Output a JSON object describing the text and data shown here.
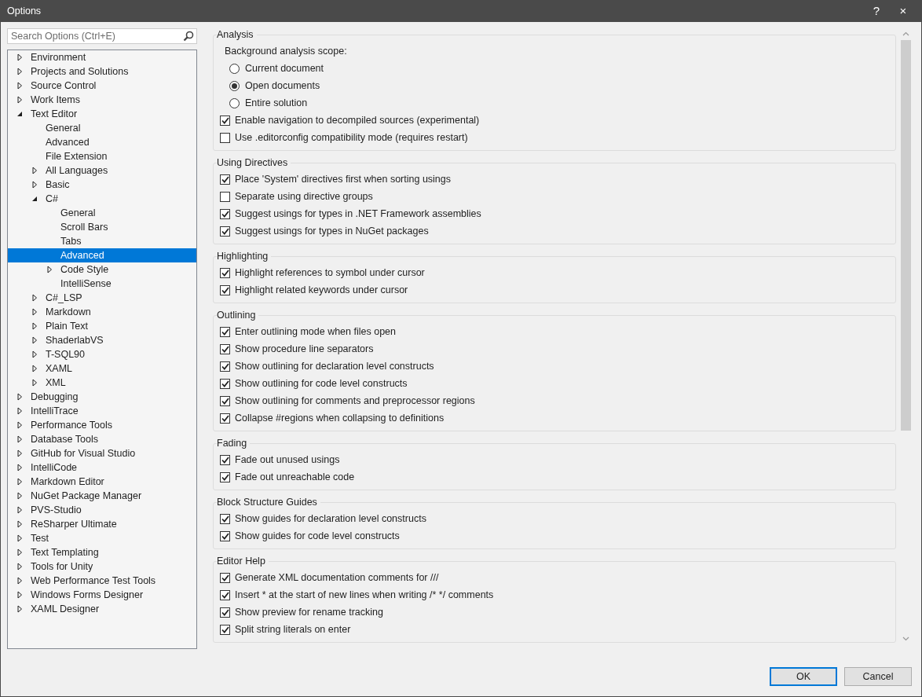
{
  "window": {
    "title": "Options",
    "help_glyph": "?",
    "close_glyph": "×"
  },
  "search": {
    "placeholder": "Search Options (Ctrl+E)"
  },
  "tree": [
    {
      "label": "Environment",
      "expanded": false,
      "selected": false
    },
    {
      "label": "Projects and Solutions",
      "expanded": false,
      "selected": false
    },
    {
      "label": "Source Control",
      "expanded": false,
      "selected": false
    },
    {
      "label": "Work Items",
      "expanded": false,
      "selected": false
    },
    {
      "label": "Text Editor",
      "expanded": true,
      "selected": false,
      "children": [
        {
          "label": "General",
          "selected": false
        },
        {
          "label": "Advanced",
          "selected": false
        },
        {
          "label": "File Extension",
          "selected": false
        },
        {
          "label": "All Languages",
          "expanded": false,
          "selected": false
        },
        {
          "label": "Basic",
          "expanded": false,
          "selected": false
        },
        {
          "label": "C#",
          "expanded": true,
          "selected": false,
          "children": [
            {
              "label": "General",
              "selected": false
            },
            {
              "label": "Scroll Bars",
              "selected": false
            },
            {
              "label": "Tabs",
              "selected": false
            },
            {
              "label": "Advanced",
              "selected": true
            },
            {
              "label": "Code Style",
              "expanded": false,
              "selected": false
            },
            {
              "label": "IntelliSense",
              "selected": false
            }
          ]
        },
        {
          "label": "C#_LSP",
          "expanded": false,
          "selected": false
        },
        {
          "label": "Markdown",
          "expanded": false,
          "selected": false
        },
        {
          "label": "Plain Text",
          "expanded": false,
          "selected": false
        },
        {
          "label": "ShaderlabVS",
          "expanded": false,
          "selected": false
        },
        {
          "label": "T-SQL90",
          "expanded": false,
          "selected": false
        },
        {
          "label": "XAML",
          "expanded": false,
          "selected": false
        },
        {
          "label": "XML",
          "expanded": false,
          "selected": false
        }
      ]
    },
    {
      "label": "Debugging",
      "expanded": false,
      "selected": false
    },
    {
      "label": "IntelliTrace",
      "expanded": false,
      "selected": false
    },
    {
      "label": "Performance Tools",
      "expanded": false,
      "selected": false
    },
    {
      "label": "Database Tools",
      "expanded": false,
      "selected": false
    },
    {
      "label": "GitHub for Visual Studio",
      "expanded": false,
      "selected": false
    },
    {
      "label": "IntelliCode",
      "expanded": false,
      "selected": false
    },
    {
      "label": "Markdown Editor",
      "expanded": false,
      "selected": false
    },
    {
      "label": "NuGet Package Manager",
      "expanded": false,
      "selected": false
    },
    {
      "label": "PVS-Studio",
      "expanded": false,
      "selected": false
    },
    {
      "label": "ReSharper Ultimate",
      "expanded": false,
      "selected": false
    },
    {
      "label": "Test",
      "expanded": false,
      "selected": false
    },
    {
      "label": "Text Templating",
      "expanded": false,
      "selected": false
    },
    {
      "label": "Tools for Unity",
      "expanded": false,
      "selected": false
    },
    {
      "label": "Web Performance Test Tools",
      "expanded": false,
      "selected": false
    },
    {
      "label": "Windows Forms Designer",
      "expanded": false,
      "selected": false
    },
    {
      "label": "XAML Designer",
      "expanded": false,
      "selected": false
    }
  ],
  "groups": [
    {
      "title": "Analysis",
      "options": [
        {
          "kind": "label",
          "label": "Background analysis scope:"
        },
        {
          "kind": "radio",
          "label": "Current document",
          "selected": false
        },
        {
          "kind": "radio",
          "label": "Open documents",
          "selected": true
        },
        {
          "kind": "radio",
          "label": "Entire solution",
          "selected": false
        },
        {
          "kind": "checkbox",
          "label": "Enable navigation to decompiled sources (experimental)",
          "checked": true
        },
        {
          "kind": "checkbox",
          "label": "Use .editorconfig compatibility mode (requires restart)",
          "checked": false
        }
      ]
    },
    {
      "title": "Using Directives",
      "options": [
        {
          "kind": "checkbox",
          "label": "Place 'System' directives first when sorting usings",
          "checked": true
        },
        {
          "kind": "checkbox",
          "label": "Separate using directive groups",
          "checked": false
        },
        {
          "kind": "checkbox",
          "label": "Suggest usings for types in .NET Framework assemblies",
          "checked": true
        },
        {
          "kind": "checkbox",
          "label": "Suggest usings for types in NuGet packages",
          "checked": true
        }
      ]
    },
    {
      "title": "Highlighting",
      "options": [
        {
          "kind": "checkbox",
          "label": "Highlight references to symbol under cursor",
          "checked": true
        },
        {
          "kind": "checkbox",
          "label": "Highlight related keywords under cursor",
          "checked": true
        }
      ]
    },
    {
      "title": "Outlining",
      "options": [
        {
          "kind": "checkbox",
          "label": "Enter outlining mode when files open",
          "checked": true
        },
        {
          "kind": "checkbox",
          "label": "Show procedure line separators",
          "checked": true
        },
        {
          "kind": "checkbox",
          "label": "Show outlining for declaration level constructs",
          "checked": true
        },
        {
          "kind": "checkbox",
          "label": "Show outlining for code level constructs",
          "checked": true
        },
        {
          "kind": "checkbox",
          "label": "Show outlining for comments and preprocessor regions",
          "checked": true
        },
        {
          "kind": "checkbox",
          "label": "Collapse #regions when collapsing to definitions",
          "checked": true
        }
      ]
    },
    {
      "title": "Fading",
      "options": [
        {
          "kind": "checkbox",
          "label": "Fade out unused usings",
          "checked": true
        },
        {
          "kind": "checkbox",
          "label": "Fade out unreachable code",
          "checked": true
        }
      ]
    },
    {
      "title": "Block Structure Guides",
      "options": [
        {
          "kind": "checkbox",
          "label": "Show guides for declaration level constructs",
          "checked": true
        },
        {
          "kind": "checkbox",
          "label": "Show guides for code level constructs",
          "checked": true
        }
      ]
    },
    {
      "title": "Editor Help",
      "options": [
        {
          "kind": "checkbox",
          "label": "Generate XML documentation comments for ///",
          "checked": true
        },
        {
          "kind": "checkbox",
          "label": "Insert * at the start of new lines when writing /* */ comments",
          "checked": true
        },
        {
          "kind": "checkbox",
          "label": "Show preview for rename tracking",
          "checked": true
        },
        {
          "kind": "checkbox",
          "label": "Split string literals on enter",
          "checked": true
        }
      ]
    }
  ],
  "buttons": [
    {
      "label": "OK",
      "default": true
    },
    {
      "label": "Cancel",
      "default": false
    }
  ]
}
